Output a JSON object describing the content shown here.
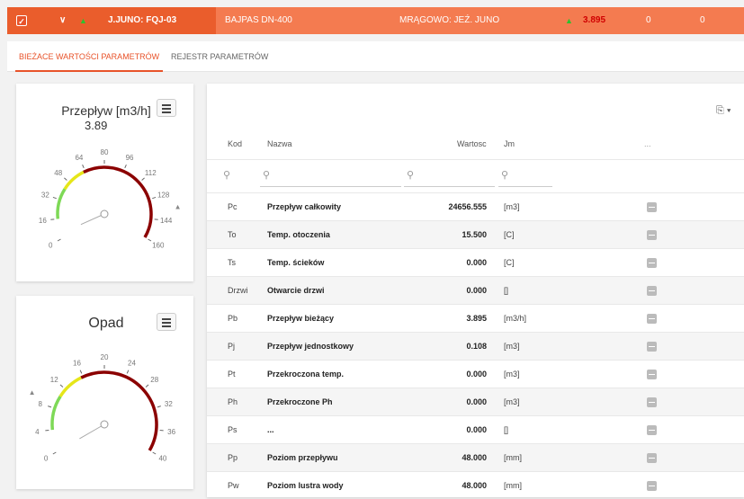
{
  "topbar": {
    "check": "✓",
    "chevron": "∨",
    "trend": "▲",
    "station": "J.JUNO: FQJ-03",
    "bypass": "BAJPAS DN-400",
    "location": "MRĄGOWO: JEŹ. JUNO",
    "trend2": "▲",
    "value": "3.895",
    "zero1": "0",
    "zero2": "0"
  },
  "tabs": [
    "BIEŻACE WARTOŚCI PARAMETRÓW",
    "REJESTR PARAMETRÓW"
  ],
  "gauge1": {
    "title": "Przepływ [m3/h]",
    "value": "3.89",
    "ticks": [
      "0",
      "16",
      "32",
      "48",
      "64",
      "80",
      "96",
      "112",
      "128",
      "144",
      "160"
    ],
    "min": 0,
    "max": 160,
    "current": 3.89,
    "marker": 136
  },
  "gauge2": {
    "title": "Opad",
    "ticks": [
      "0",
      "4",
      "8",
      "12",
      "16",
      "20",
      "24",
      "28",
      "32",
      "36",
      "40"
    ],
    "min": 0,
    "max": 40,
    "current": 0,
    "marker": 9
  },
  "table": {
    "headers": {
      "kod": "Kod",
      "nazwa": "Nazwa",
      "wartosc": "Wartosc",
      "jm": "Jm",
      "more": "..."
    },
    "rows": [
      {
        "kod": "Pc",
        "nazwa": "Przepływ całkowity",
        "wartosc": "24656.555",
        "jm": "[m3]"
      },
      {
        "kod": "To",
        "nazwa": "Temp. otoczenia",
        "wartosc": "15.500",
        "jm": "[C]"
      },
      {
        "kod": "Ts",
        "nazwa": "Temp. ścieków",
        "wartosc": "0.000",
        "jm": "[C]"
      },
      {
        "kod": "Drzwi",
        "nazwa": "Otwarcie drzwi",
        "wartosc": "0.000",
        "jm": "[]"
      },
      {
        "kod": "Pb",
        "nazwa": "Przepływ bieżący",
        "wartosc": "3.895",
        "jm": "[m3/h]"
      },
      {
        "kod": "Pj",
        "nazwa": "Przepływ jednostkowy",
        "wartosc": "0.108",
        "jm": "[m3]"
      },
      {
        "kod": "Pt",
        "nazwa": "Przekroczona temp.",
        "wartosc": "0.000",
        "jm": "[m3]"
      },
      {
        "kod": "Ph",
        "nazwa": "Przekroczone Ph",
        "wartosc": "0.000",
        "jm": "[m3]"
      },
      {
        "kod": "Ps",
        "nazwa": "...",
        "wartosc": "0.000",
        "jm": "[]"
      },
      {
        "kod": "Pp",
        "nazwa": "Poziom przepływu",
        "wartosc": "48.000",
        "jm": "[mm]"
      },
      {
        "kod": "Pw",
        "nazwa": "Poziom lustra wody",
        "wartosc": "48.000",
        "jm": "[mm]"
      }
    ]
  },
  "icons": {
    "filter": "search-icon",
    "export": "file-export-icon",
    "menu": "hamburger-menu-icon",
    "action": "minus-box-icon"
  },
  "colors": {
    "header": "#f47b50",
    "headerDark": "#ea5d2c",
    "accent": "#e8532a",
    "arcGreen": "#7ed957",
    "arcYellow": "#e6e619",
    "arcRed": "#8b0000"
  }
}
